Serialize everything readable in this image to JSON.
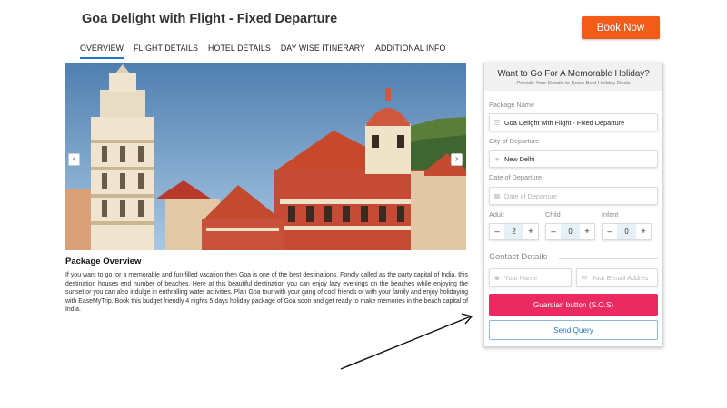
{
  "header": {
    "title": "Goa Delight with Flight - Fixed Departure",
    "book_now": "Book Now"
  },
  "tabs": [
    {
      "label": "OVERVIEW",
      "active": true
    },
    {
      "label": "FLIGHT DETAILS",
      "active": false
    },
    {
      "label": "HOTEL DETAILS",
      "active": false
    },
    {
      "label": "DAY WISE ITINERARY",
      "active": false
    },
    {
      "label": "ADDITIONAL INFO",
      "active": false
    }
  ],
  "carousel": {
    "prev_icon": "chevron-left-icon",
    "next_icon": "chevron-right-icon"
  },
  "overview": {
    "title": "Package Overview",
    "text": "If you want to go for a memorable and fun-filled vacation then Goa is one of the best destinations. Fondly called as the party capital of India, this destination houses end number of beaches. Here at this beautiful destination you can enjoy lazy evenings on the beaches while enjoying the sunset or you can also indulge in enthralling water activities. Plan Goa tour with your gang of cool friends or with your family and enjoy holidaying with EaseMyTrip. Book this budget friendly 4 nights 5 days holiday package of Goa soon and get ready to make memories in the beach capital of India."
  },
  "form": {
    "title": "Want to Go For A Memorable Holiday?",
    "subtitle": "Provide Your Details to Know Best Holiday Deals",
    "package_label": "Package Name",
    "package_value": "Goa Delight with Flight - Fixed Departure",
    "city_label": "City of Departure",
    "city_value": "New Delhi",
    "date_label": "Date of Departure",
    "date_placeholder": "Date of Departure",
    "adult_label": "Adult",
    "adult_value": "2",
    "child_label": "Child",
    "child_value": "0",
    "infant_label": "Infant",
    "infant_value": "0",
    "minus": "–",
    "plus": "+",
    "contact_title": "Contact Details",
    "name_placeholder": "Your Name",
    "email_placeholder": "Your E-mail Addres",
    "sos_button": "Guardian button (S.O.S)",
    "send_button": "Send Query"
  },
  "colors": {
    "book_now": "#f35b18",
    "sos": "#ea2a61",
    "send_border": "#8fb8de",
    "tab_active": "#2276c2"
  }
}
